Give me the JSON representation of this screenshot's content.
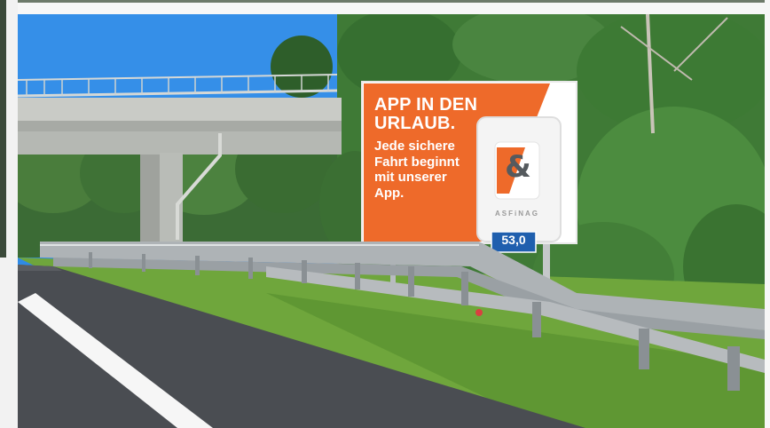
{
  "billboard": {
    "headline_line1": "APP IN DEN",
    "headline_line2": "URLAUB.",
    "sub_line1": "Jede sichere",
    "sub_line2": "Fahrt beginnt",
    "sub_line3": "mit unserer",
    "sub_line4": "App.",
    "brand_symbol": "&",
    "brand_name": "ASFiNAG",
    "accent_color": "#ee6a2a"
  },
  "kilometer_marker": {
    "value": "53,0",
    "color": "#1f5fae"
  },
  "scene_colors": {
    "sky": "#2f8be6",
    "foliage": "#3e7a36",
    "grass": "#6fa63c",
    "road": "#4a4d52",
    "guardrail": "#a9aeb2"
  }
}
